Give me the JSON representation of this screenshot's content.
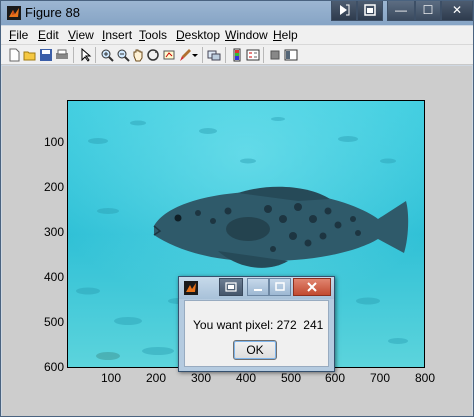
{
  "window": {
    "title": "Figure 88",
    "buttons": {
      "minimize": "—",
      "maximize": "☐",
      "close": "✕"
    }
  },
  "menubar": {
    "items": [
      {
        "label": "File",
        "mnemonic": "F"
      },
      {
        "label": "Edit",
        "mnemonic": "E"
      },
      {
        "label": "View",
        "mnemonic": "V"
      },
      {
        "label": "Insert",
        "mnemonic": "I"
      },
      {
        "label": "Tools",
        "mnemonic": "T"
      },
      {
        "label": "Desktop",
        "mnemonic": "D"
      },
      {
        "label": "Window",
        "mnemonic": "W"
      },
      {
        "label": "Help",
        "mnemonic": "H"
      }
    ]
  },
  "toolbar": {
    "icons": [
      "new-figure-icon",
      "open-file-icon",
      "save-icon",
      "print-icon",
      "edit-plot-arrow-icon",
      "zoom-in-icon",
      "zoom-out-icon",
      "pan-hand-icon",
      "rotate-3d-icon",
      "data-cursor-icon",
      "brush-icon",
      "link-plot-icon",
      "colorbar-icon",
      "legend-icon",
      "hide-plot-tools-icon",
      "show-plot-tools-icon"
    ]
  },
  "axes": {
    "yticks": [
      "100",
      "200",
      "300",
      "400",
      "500",
      "600"
    ],
    "xticks": [
      "100",
      "200",
      "300",
      "400",
      "500",
      "600",
      "700",
      "800"
    ]
  },
  "dialog": {
    "message": "You want pixel: 272  241",
    "ok_label": "OK"
  },
  "colors": {
    "water": "#33c3d8",
    "fish": "#2f5a6a",
    "titlebar": "#8faecf"
  }
}
